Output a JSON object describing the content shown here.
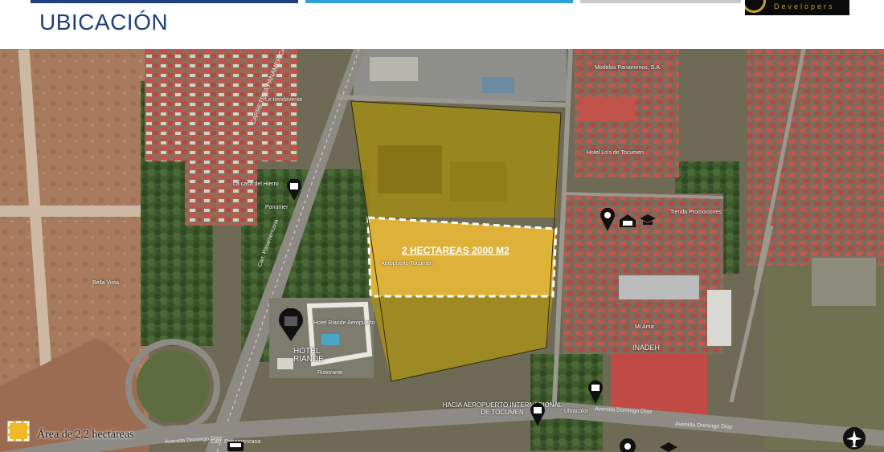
{
  "header": {
    "title": "UBICACIÓN",
    "title_color": "#1f3f7a",
    "bar_colors": [
      "#1f3f7a",
      "#2e9fd8",
      "#c7c9cc"
    ]
  },
  "logo": {
    "text": "Developers",
    "text_color": "#c9a227",
    "icon": "g-logo-icon"
  },
  "map": {
    "area_label": "2 HECTAREAS 2000 M2",
    "highlight_color": "#f2b82c",
    "places": [
      "Modelos Panamenos, S.A.",
      "Aeropuerto Tocumen",
      "Hotel Riande Aeropuerto",
      "Ristorante",
      "Hotel Lo's de Tocumen",
      "Tienda Promociones",
      "Mi Ama",
      "Ultracolor",
      "Le tiendaventa",
      "La casa del Hierro",
      "Bella Vista",
      "Panamer",
      "Carr. Panamericana"
    ],
    "roads": [
      "CARRETERA PANAMERICANA",
      "Avenida Domingo Díaz",
      "Avenida Domingo Díaz",
      "Avenida Domingo Díaz",
      "Carr. Panamericana"
    ],
    "hotel_label_line1": "HOTEL",
    "hotel_label_line2": "RIANDE",
    "airport_label": "HACIA AEROPUERTO INTERNACIONAL DE TOCUMEN",
    "inadeh_label": "INADEH",
    "icons": [
      "map-pin-icon",
      "bus-stop-icon",
      "school-icon",
      "store-icon",
      "airplane-icon"
    ]
  },
  "legend": {
    "label": "Área de 2.2 hectáreas",
    "swatch_color": "#f2b82c"
  }
}
